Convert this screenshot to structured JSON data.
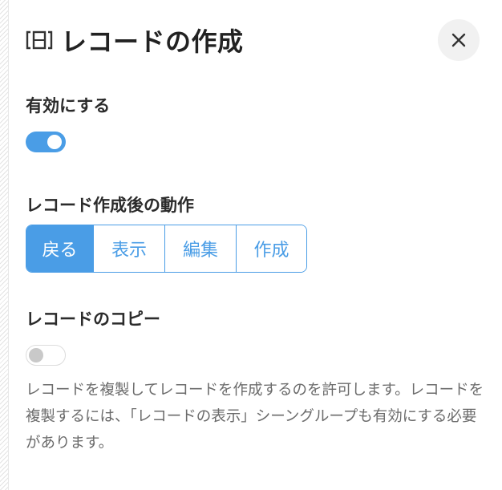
{
  "header": {
    "title": "レコードの作成",
    "icon": "record-frame-icon",
    "close_icon": "close-icon"
  },
  "enable": {
    "label": "有効にする",
    "toggle_on": true
  },
  "after_create": {
    "label": "レコード作成後の動作",
    "options": [
      "戻る",
      "表示",
      "編集",
      "作成"
    ],
    "selected": "戻る"
  },
  "copy": {
    "label": "レコードのコピー",
    "toggle_on": false,
    "description": "レコードを複製してレコードを作成するのを許可します。レコードを複製するには、「レコードの表示」シーングループも有効にする必要があります。"
  },
  "colors": {
    "accent": "#4a9de6",
    "text": "#2b2b2b",
    "muted": "#6b6b6b"
  }
}
